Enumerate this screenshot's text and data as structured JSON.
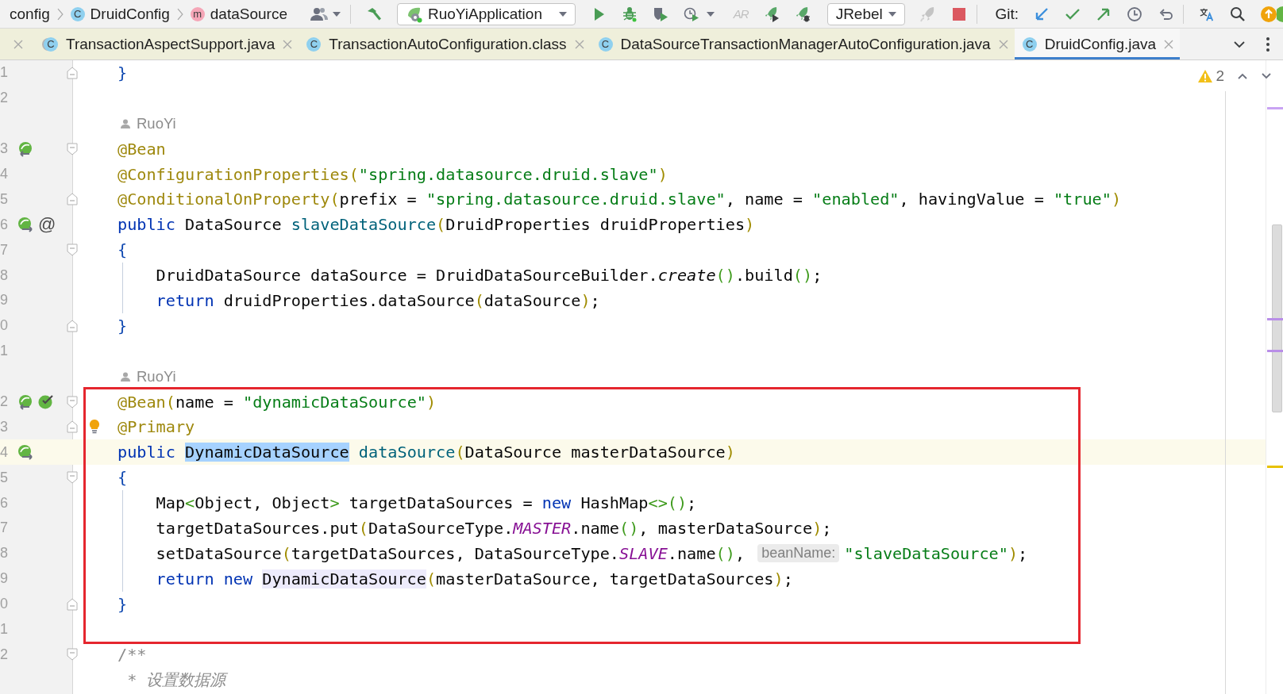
{
  "toolbar": {
    "breadcrumbs": [
      {
        "label": "config"
      },
      {
        "label": "DruidConfig",
        "icon_letter": "C",
        "kind": "class"
      },
      {
        "label": "dataSource",
        "icon_letter": "m",
        "kind": "method"
      }
    ],
    "run_config": "RuoYiApplication",
    "ar_button": {
      "label": "AR",
      "disabled": true
    },
    "jrebel": "JRebel",
    "git_label": "Git:"
  },
  "tabs": [
    {
      "label": "TransactionAspectSupport.java",
      "icon_letter": "C",
      "kind": "library",
      "selected": false
    },
    {
      "label": "TransactionAutoConfiguration.class",
      "icon_letter": "C",
      "kind": "class",
      "selected": false
    },
    {
      "label": "DataSourceTransactionManagerAutoConfiguration.java",
      "icon_letter": "C",
      "kind": "class",
      "selected": false
    },
    {
      "label": "DruidConfig.java",
      "icon_letter": "C",
      "kind": "class",
      "selected": true
    }
  ],
  "inspections": {
    "warnings": "2"
  },
  "sections": [
    {
      "kind": "plain",
      "lines": [
        {
          "kind": "code",
          "number": "1",
          "fold": {
            "kind": "end"
          },
          "current": false,
          "tokens": [
            {
              "kind": "brace",
              "text": "}"
            }
          ]
        },
        {
          "kind": "code",
          "number": "2",
          "current": false
        },
        {
          "kind": "author",
          "author": "RuoYi",
          "current": false
        },
        {
          "kind": "code",
          "number": "3",
          "gutter_icons": [
            {
              "kind": "nav_left"
            }
          ],
          "fold": {
            "kind": "start"
          },
          "current": false,
          "tokens": [
            {
              "kind": "annotation",
              "text": "@Bean"
            }
          ]
        },
        {
          "kind": "code",
          "number": "4",
          "current": false,
          "tokens": [
            {
              "kind": "annotation",
              "text": "@ConfigurationProperties"
            },
            {
              "kind": "bracket1",
              "text": "("
            },
            {
              "kind": "string",
              "text": "\"spring.datasource.druid.slave\""
            },
            {
              "kind": "bracket1",
              "text": ")"
            }
          ]
        },
        {
          "kind": "code",
          "number": "5",
          "fold": {
            "kind": "end"
          },
          "current": false,
          "tokens": [
            {
              "kind": "annotation",
              "text": "@ConditionalOnProperty"
            },
            {
              "kind": "bracket1",
              "text": "("
            },
            {
              "kind": "plain",
              "text": "prefix = "
            },
            {
              "kind": "string",
              "text": "\"spring.datasource.druid.slave\""
            },
            {
              "kind": "plain",
              "text": ", name = "
            },
            {
              "kind": "string",
              "text": "\"enabled\""
            },
            {
              "kind": "plain",
              "text": ", havingValue = "
            },
            {
              "kind": "string",
              "text": "\"true\""
            },
            {
              "kind": "bracket1",
              "text": ")"
            }
          ]
        },
        {
          "kind": "code",
          "number": "6",
          "gutter_icons": [
            {
              "kind": "nav_right"
            },
            {
              "kind": "text",
              "text": "@"
            }
          ],
          "current": false,
          "tokens": [
            {
              "kind": "keyword",
              "text": "public"
            },
            {
              "kind": "plain",
              "text": " DataSource "
            },
            {
              "kind": "method",
              "text": "slaveDataSource"
            },
            {
              "kind": "bracket1",
              "text": "("
            },
            {
              "kind": "plain",
              "text": "DruidProperties druidProperties"
            },
            {
              "kind": "bracket1",
              "text": ")"
            }
          ]
        },
        {
          "kind": "code",
          "number": "7",
          "fold": {
            "kind": "start"
          },
          "current": false,
          "tokens": [
            {
              "kind": "brace",
              "text": "{"
            }
          ],
          "children": [
            {
              "kind": "code",
              "number": "8",
              "current": false,
              "tokens": [
                {
                  "kind": "plain",
                  "text": "DruidDataSource dataSource = DruidDataSourceBuilder."
                },
                {
                  "kind": "static",
                  "text": "create"
                },
                {
                  "kind": "bracket2",
                  "text": "()"
                },
                {
                  "kind": "plain",
                  "text": ".build"
                },
                {
                  "kind": "bracket2",
                  "text": "()"
                },
                {
                  "kind": "plain",
                  "text": ";"
                }
              ]
            },
            {
              "kind": "code",
              "number": "9",
              "current": false,
              "tokens": [
                {
                  "kind": "keyword",
                  "text": "return"
                },
                {
                  "kind": "plain",
                  "text": " druidProperties.dataSource"
                },
                {
                  "kind": "bracket1",
                  "text": "("
                },
                {
                  "kind": "plain",
                  "text": "dataSource"
                },
                {
                  "kind": "bracket1",
                  "text": ")"
                },
                {
                  "kind": "plain",
                  "text": ";"
                }
              ]
            }
          ]
        },
        {
          "kind": "code",
          "number": "0",
          "fold": {
            "kind": "end"
          },
          "current": false,
          "tokens": [
            {
              "kind": "brace",
              "text": "}"
            }
          ]
        },
        {
          "kind": "code",
          "number": "1",
          "current": false
        },
        {
          "kind": "author",
          "author": "RuoYi",
          "current": false
        }
      ]
    },
    {
      "kind": "framed",
      "lines": [
        {
          "kind": "code",
          "number": "2",
          "gutter_icons": [
            {
              "kind": "nav_left"
            },
            {
              "kind": "check"
            }
          ],
          "fold": {
            "kind": "start"
          },
          "current": false,
          "tokens": [
            {
              "kind": "annotation",
              "text": "@Bean"
            },
            {
              "kind": "bracket1",
              "text": "("
            },
            {
              "kind": "plain",
              "text": "name = "
            },
            {
              "kind": "string",
              "text": "\"dynamicDataSource\""
            },
            {
              "kind": "bracket1",
              "text": ")"
            }
          ]
        },
        {
          "kind": "code",
          "number": "3",
          "fold": {
            "kind": "end"
          },
          "marker": {
            "kind": "bulb"
          },
          "current": false,
          "tokens": [
            {
              "kind": "annotation",
              "text": "@Primary"
            }
          ]
        },
        {
          "kind": "code",
          "number": "4",
          "gutter_icons": [
            {
              "kind": "nav_right"
            }
          ],
          "current": true,
          "tokens": [
            {
              "kind": "keyword",
              "text": "public "
            },
            {
              "kind": "selection",
              "text": "DynamicDataSource"
            },
            {
              "kind": "method",
              "text": " dataSource"
            },
            {
              "kind": "bracket1",
              "text": "("
            },
            {
              "kind": "plain",
              "text": "DataSource masterDataSource"
            },
            {
              "kind": "bracket1",
              "text": ")"
            }
          ]
        },
        {
          "kind": "code",
          "number": "5",
          "fold": {
            "kind": "start"
          },
          "current": false,
          "tokens": [
            {
              "kind": "brace",
              "text": "{"
            }
          ],
          "children": [
            {
              "kind": "code",
              "number": "6",
              "current": false,
              "tokens": [
                {
                  "kind": "plain",
                  "text": "Map"
                },
                {
                  "kind": "bracket2",
                  "text": "<"
                },
                {
                  "kind": "plain",
                  "text": "Object, Object"
                },
                {
                  "kind": "bracket2",
                  "text": ">"
                },
                {
                  "kind": "plain",
                  "text": " targetDataSources = "
                },
                {
                  "kind": "keyword",
                  "text": "new"
                },
                {
                  "kind": "plain",
                  "text": " HashMap"
                },
                {
                  "kind": "bracket2",
                  "text": "<>()"
                },
                {
                  "kind": "plain",
                  "text": ";"
                }
              ]
            },
            {
              "kind": "code",
              "number": "7",
              "current": false,
              "tokens": [
                {
                  "kind": "plain",
                  "text": "targetDataSources.put"
                },
                {
                  "kind": "bracket1",
                  "text": "("
                },
                {
                  "kind": "plain",
                  "text": "DataSourceType."
                },
                {
                  "kind": "constant",
                  "text": "MASTER"
                },
                {
                  "kind": "plain",
                  "text": ".name"
                },
                {
                  "kind": "bracket2",
                  "text": "()"
                },
                {
                  "kind": "plain",
                  "text": ", masterDataSource"
                },
                {
                  "kind": "bracket1",
                  "text": ")"
                },
                {
                  "kind": "plain",
                  "text": ";"
                }
              ]
            },
            {
              "kind": "code",
              "number": "8",
              "current": false,
              "tokens": [
                {
                  "kind": "plain",
                  "text": "setDataSource"
                },
                {
                  "kind": "bracket1",
                  "text": "("
                },
                {
                  "kind": "plain",
                  "text": "targetDataSources, DataSourceType."
                },
                {
                  "kind": "constant",
                  "text": "SLAVE"
                },
                {
                  "kind": "plain",
                  "text": ".name"
                },
                {
                  "kind": "bracket2",
                  "text": "()"
                },
                {
                  "kind": "plain",
                  "text": ", "
                },
                {
                  "kind": "hint",
                  "text": "beanName:"
                },
                {
                  "kind": "string",
                  "text": "\"slaveDataSource\""
                },
                {
                  "kind": "bracket1",
                  "text": ")"
                },
                {
                  "kind": "plain",
                  "text": ";"
                }
              ]
            },
            {
              "kind": "code",
              "number": "9",
              "current": false,
              "tokens": [
                {
                  "kind": "keyword",
                  "text": "return new "
                },
                {
                  "kind": "usage",
                  "text": "DynamicDataSource"
                },
                {
                  "kind": "bracket1",
                  "text": "("
                },
                {
                  "kind": "plain",
                  "text": "masterDataSource, targetDataSources"
                },
                {
                  "kind": "bracket1",
                  "text": ")"
                },
                {
                  "kind": "plain",
                  "text": ";"
                }
              ]
            }
          ]
        },
        {
          "kind": "code",
          "number": "0",
          "fold": {
            "kind": "end"
          },
          "current": false,
          "tokens": [
            {
              "kind": "brace",
              "text": "}"
            }
          ]
        },
        {
          "kind": "code",
          "number": "1",
          "current": false
        }
      ]
    },
    {
      "kind": "plain",
      "lines": [
        {
          "kind": "code",
          "number": "2",
          "fold": {
            "kind": "start"
          },
          "current": false,
          "tokens": [
            {
              "kind": "comment",
              "text": "/**"
            }
          ]
        },
        {
          "kind": "code",
          "current": false,
          "tokens": [
            {
              "kind": "comment",
              "text": " * "
            },
            {
              "kind": "doc",
              "text": "设置数据源"
            }
          ]
        }
      ]
    }
  ]
}
